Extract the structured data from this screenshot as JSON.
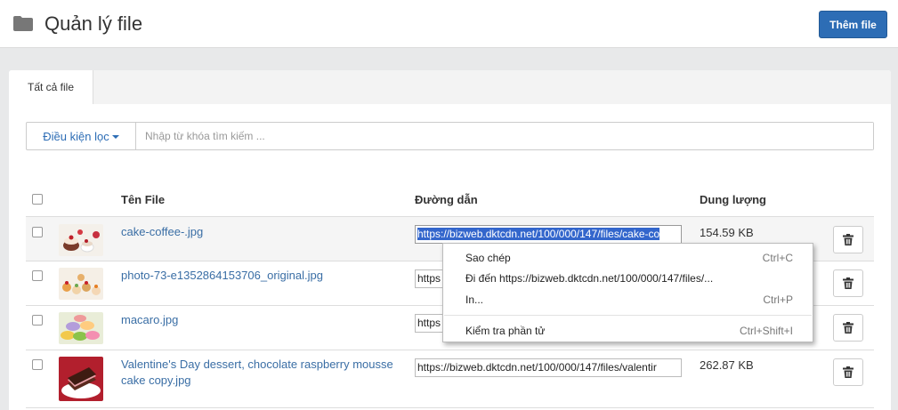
{
  "header": {
    "title": "Quản lý file",
    "add_button": "Thêm file"
  },
  "tabs": [
    {
      "label": "Tất cả file"
    }
  ],
  "filter": {
    "button_label": "Điều kiện lọc",
    "search_placeholder": "Nhập từ khóa tìm kiếm ..."
  },
  "table": {
    "columns": {
      "name": "Tên File",
      "path": "Đường dẫn",
      "size": "Dung lượng"
    },
    "rows": [
      {
        "name": "cake-coffee-.jpg",
        "url": "https://bizweb.dktcdn.net/100/000/147/files/cake-co",
        "size": "154.59 KB"
      },
      {
        "name": "photo-73-e1352864153706_original.jpg",
        "url": "https",
        "size": ""
      },
      {
        "name": "macaro.jpg",
        "url": "https",
        "size": ""
      },
      {
        "name_line1": "Valentine's Day dessert, chocolate raspberry mousse",
        "name_line2": "cake copy.jpg",
        "url": "https://bizweb.dktcdn.net/100/000/147/files/valentir",
        "size": "262.87 KB"
      }
    ]
  },
  "context_menu": {
    "items": [
      {
        "label": "Sao chép",
        "shortcut": "Ctrl+C"
      },
      {
        "label": "Đi đến https://bizweb.dktcdn.net/100/000/147/files/...",
        "shortcut": ""
      },
      {
        "label": "In...",
        "shortcut": "Ctrl+P"
      },
      {
        "label": "Kiểm tra phần tử",
        "shortcut": "Ctrl+Shift+I"
      }
    ]
  },
  "colors": {
    "primary": "#2d6db5",
    "link": "#3a6ea5",
    "selection": "#3366cc"
  },
  "icons": {
    "header": "folder-icon",
    "delete": "trash-icon",
    "filter_caret": "caret-down-icon"
  }
}
